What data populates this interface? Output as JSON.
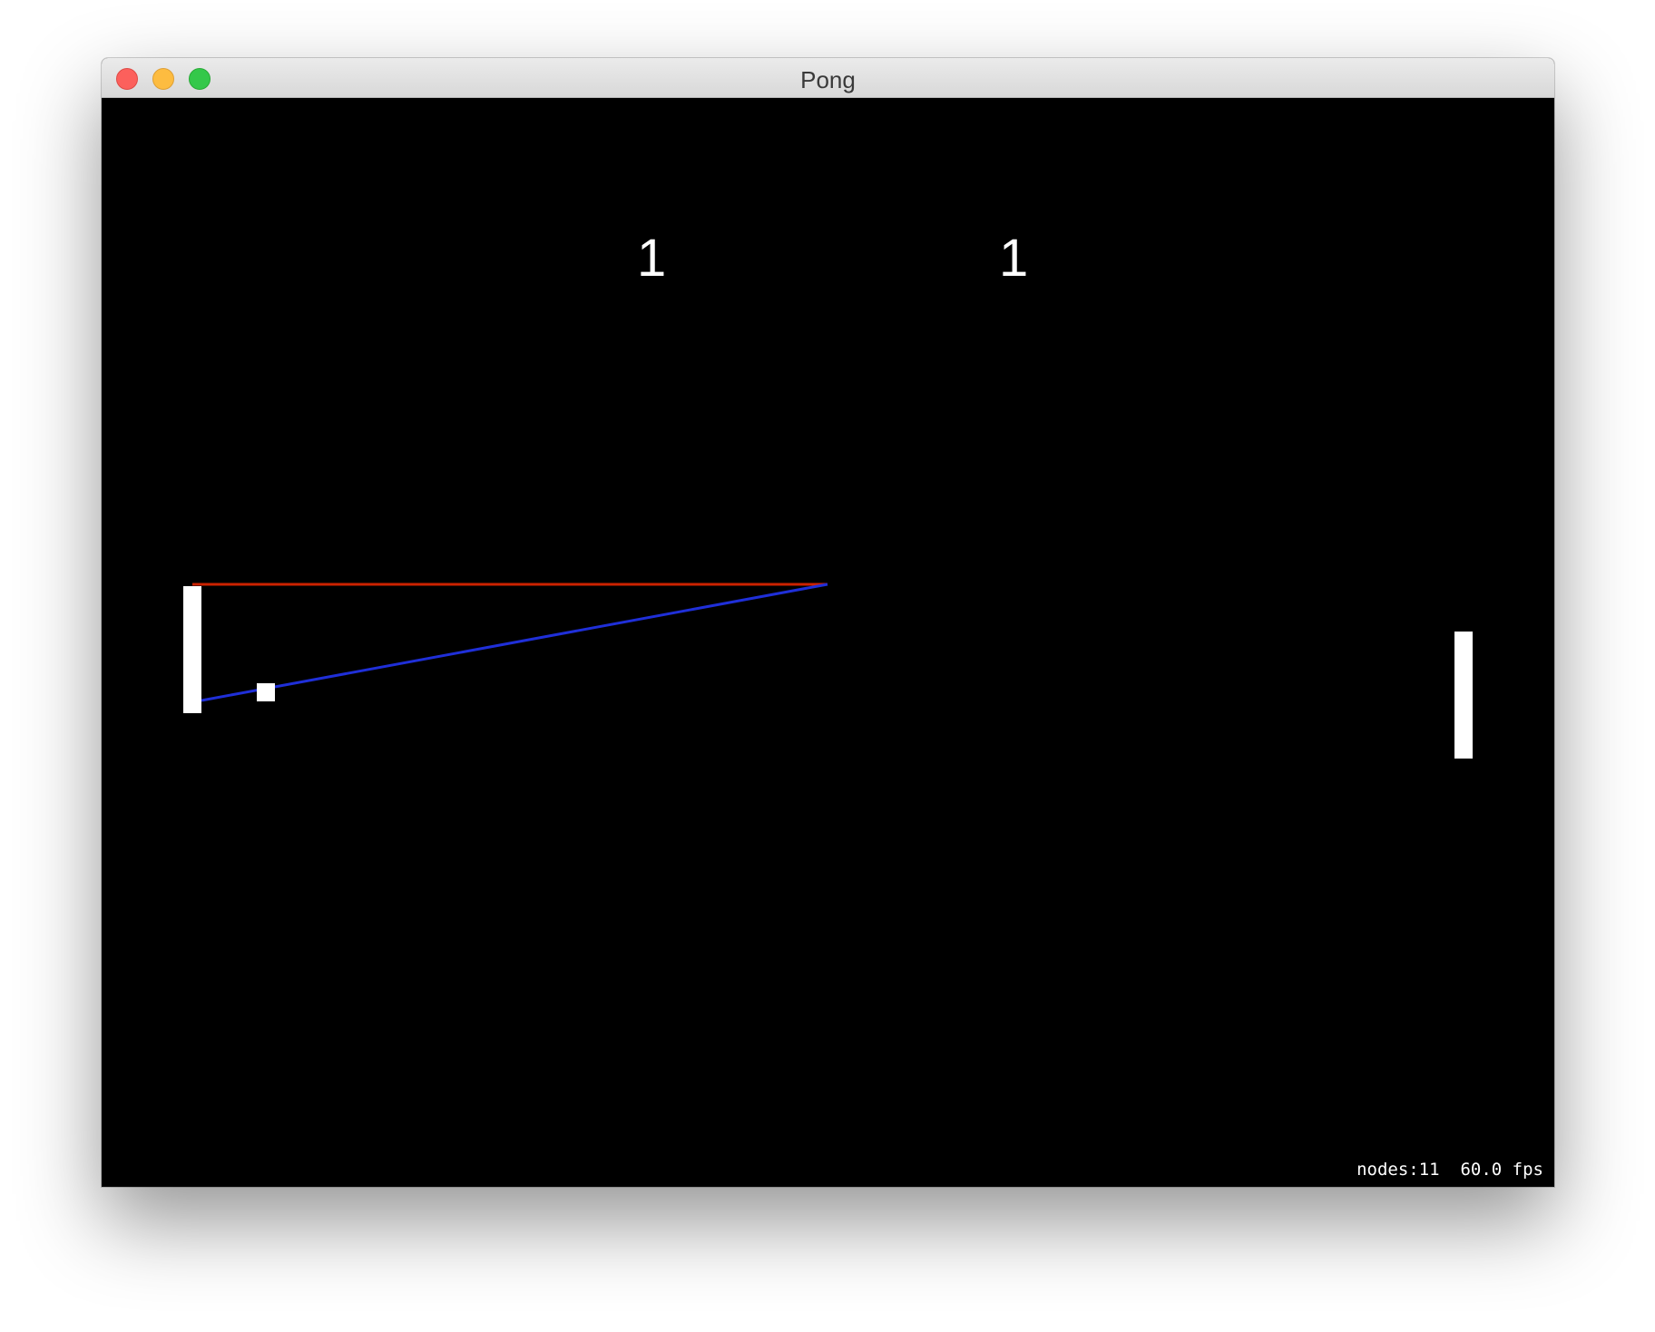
{
  "window": {
    "title": "Pong"
  },
  "scoreboard": {
    "left_score": "1",
    "right_score": "1"
  },
  "debug_overlay": {
    "nodes_label": "nodes:11",
    "fps_label": "60.0 fps"
  },
  "colors": {
    "background": "#000000",
    "paddle": "#ffffff",
    "ball": "#ffffff",
    "red_line": "#cc2200",
    "blue_line": "#1f2fd8"
  }
}
